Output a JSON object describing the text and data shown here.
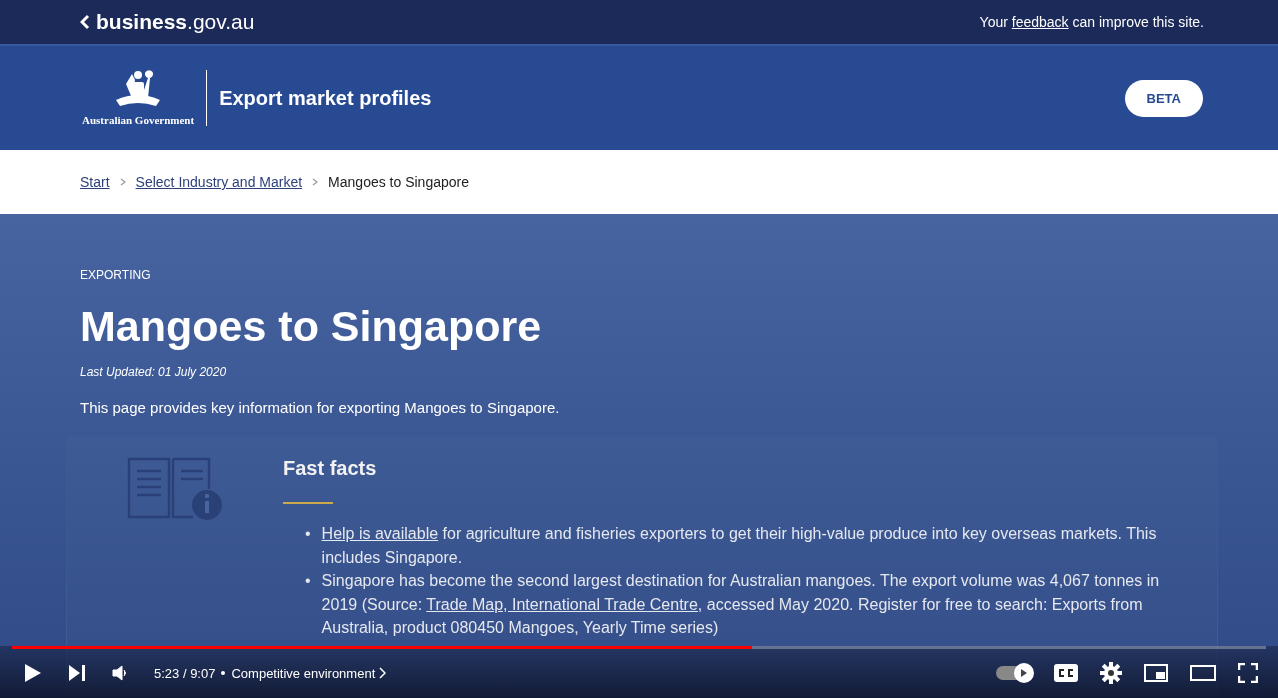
{
  "site_bar": {
    "logo": "**business**.gov.au",
    "feedback": {
      "before": "Your",
      "link": "feedback",
      "after": "can improve this site."
    }
  },
  "header": {
    "agency": "Australian Government",
    "title": "Export market profiles",
    "badge": "BETA"
  },
  "breadcrumbs": [
    {
      "label": "Start",
      "link": true
    },
    {
      "label": "Select Industry and Market",
      "link": true
    },
    {
      "label": "Mangoes to Singapore",
      "link": false
    }
  ],
  "page": {
    "eyebrow": "EXPORTING",
    "title": "Mangoes to Singapore",
    "updated": "Last Updated: 01 July 2020",
    "intro": "This page provides key information for exporting Mangoes to Singapore."
  },
  "fast_facts": {
    "title": "Fast facts",
    "bullets": [
      {
        "marker": "•",
        "parts": [
          {
            "text": "Help is available",
            "link": true
          },
          {
            "text": " for agriculture and fisheries exporters to get their high-value produce into key overseas markets. This includes Singapore.",
            "link": false
          }
        ]
      },
      {
        "marker": "•",
        "parts": [
          {
            "text": "Singapore has become the second largest destination for Australian mangoes. The export volume was 4,067 tonnes in 2019 (Source: ",
            "link": false
          },
          {
            "text": "Trade Map, International Trade Centre",
            "link": true
          },
          {
            "text": ", accessed May 2020. Register for free to search: Exports from Australia, product 080450 Mangoes, Yearly Time series)",
            "link": false
          }
        ]
      }
    ]
  },
  "player": {
    "level": 0.59,
    "time": "5:23 / 9:07",
    "chapter": "Competitive environment",
    "autoplay": {
      "on": true
    }
  }
}
